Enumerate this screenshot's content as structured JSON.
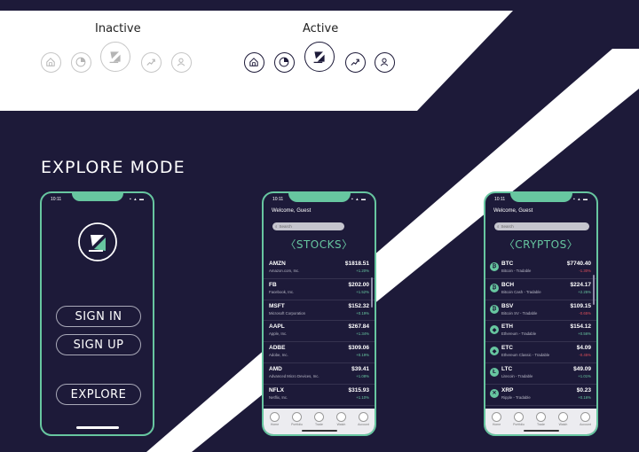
{
  "legend": {
    "inactive_label": "Inactive",
    "active_label": "Active",
    "icons": [
      "home-icon",
      "portfolio-icon",
      "trade-logo-icon",
      "trend-icon",
      "account-icon"
    ]
  },
  "colors": {
    "background": "#1d1a39",
    "accent": "#67c6a0",
    "negative": "#e0505a",
    "light": "#ffffff"
  },
  "explore_title": "EXPLORE MODE",
  "status": {
    "time": "10:11",
    "icons": "▪ ▴ ▬"
  },
  "phone1": {
    "sign_in": "SIGN IN",
    "sign_up": "SIGN UP",
    "explore": "EXPLORE"
  },
  "phone2": {
    "welcome": "Welcome, Guest",
    "search_placeholder": "Search",
    "title": "STOCKS",
    "rows": [
      {
        "symbol": "AMZN",
        "name": "Amazon.com, Inc.",
        "price": "$1818.51",
        "change": "+1.20%",
        "dir": "up"
      },
      {
        "symbol": "FB",
        "name": "Facebook, Inc.",
        "price": "$202.00",
        "change": "+1.52%",
        "dir": "up"
      },
      {
        "symbol": "MSFT",
        "name": "Microsoft Corporation",
        "price": "$152.32",
        "change": "+0.19%",
        "dir": "up"
      },
      {
        "symbol": "AAPL",
        "name": "Apple, Inc.",
        "price": "$267.84",
        "change": "+1.34%",
        "dir": "up"
      },
      {
        "symbol": "ADBE",
        "name": "Adobe, Inc.",
        "price": "$309.06",
        "change": "+0.19%",
        "dir": "up"
      },
      {
        "symbol": "AMD",
        "name": "Advanced Micro Devices, Inc.",
        "price": "$39.41",
        "change": "+1.08%",
        "dir": "up"
      },
      {
        "symbol": "NFLX",
        "name": "Netflix, Inc.",
        "price": "$315.93",
        "change": "+1.10%",
        "dir": "up"
      }
    ]
  },
  "phone3": {
    "welcome": "Welcome, Guest",
    "search_placeholder": "Search",
    "title": "CRYPTOS",
    "rows": [
      {
        "symbol": "BTC",
        "name": "Bitcoin - Tradable",
        "price": "$7740.40",
        "change": "-1.30%",
        "dir": "down",
        "glyph": "₿"
      },
      {
        "symbol": "BCH",
        "name": "Bitcoin Cash - Tradable",
        "price": "$224.17",
        "change": "+2.25%",
        "dir": "up",
        "glyph": "₿"
      },
      {
        "symbol": "BSV",
        "name": "Bitcoin SV - Tradable",
        "price": "$109.15",
        "change": "-0.65%",
        "dir": "down",
        "glyph": "₿"
      },
      {
        "symbol": "ETH",
        "name": "Ethereum - Tradable",
        "price": "$154.12",
        "change": "+0.56%",
        "dir": "up",
        "glyph": "◆"
      },
      {
        "symbol": "ETC",
        "name": "Ethereum Classic - Tradable",
        "price": "$4.09",
        "change": "-0.45%",
        "dir": "down",
        "glyph": "◆"
      },
      {
        "symbol": "LTC",
        "name": "Litecoin - Tradable",
        "price": "$49.09",
        "change": "+1.01%",
        "dir": "up",
        "glyph": "Ł"
      },
      {
        "symbol": "XRP",
        "name": "Ripple - Tradable",
        "price": "$0.23",
        "change": "+0.16%",
        "dir": "up",
        "glyph": "✕"
      }
    ]
  },
  "tabs": [
    "Home",
    "Portfolio",
    "Trade",
    "Watch",
    "Account"
  ]
}
